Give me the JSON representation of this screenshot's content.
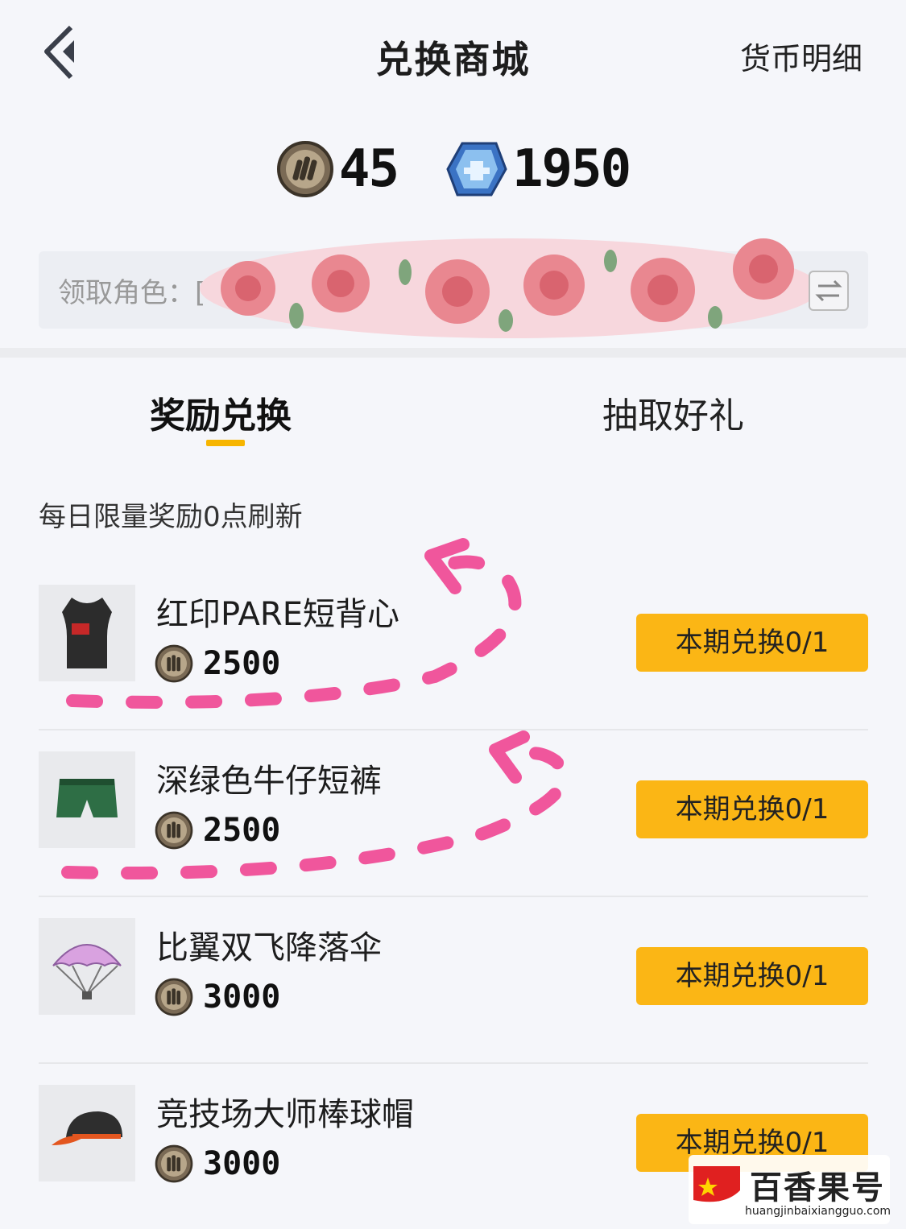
{
  "header": {
    "title": "兑换商城",
    "currency_detail_label": "货币明细"
  },
  "balances": {
    "coin": "45",
    "ticket": "1950"
  },
  "role": {
    "label": "领取角色：["
  },
  "tabs": [
    {
      "label": "奖励兑换",
      "active": true
    },
    {
      "label": "抽取好礼",
      "active": false
    }
  ],
  "notice": "每日限量奖励0点刷新",
  "items": [
    {
      "name": "红印PARE短背心",
      "price": "2500",
      "button": "本期兑换0/1",
      "icon": "vest-icon"
    },
    {
      "name": "深绿色牛仔短裤",
      "price": "2500",
      "button": "本期兑换0/1",
      "icon": "shorts-icon"
    },
    {
      "name": "比翼双飞降落伞",
      "price": "3000",
      "button": "本期兑换0/1",
      "icon": "parachute-icon"
    },
    {
      "name": "竞技场大师棒球帽",
      "price": "3000",
      "button": "本期兑换0/1",
      "icon": "cap-icon"
    }
  ],
  "watermark": {
    "text": "百香果号",
    "url": "huangjinbaixiangguo.com"
  },
  "colors": {
    "accent": "#fbb615",
    "tab_underline": "#f7b500",
    "annotation_pink": "#f0569c"
  }
}
